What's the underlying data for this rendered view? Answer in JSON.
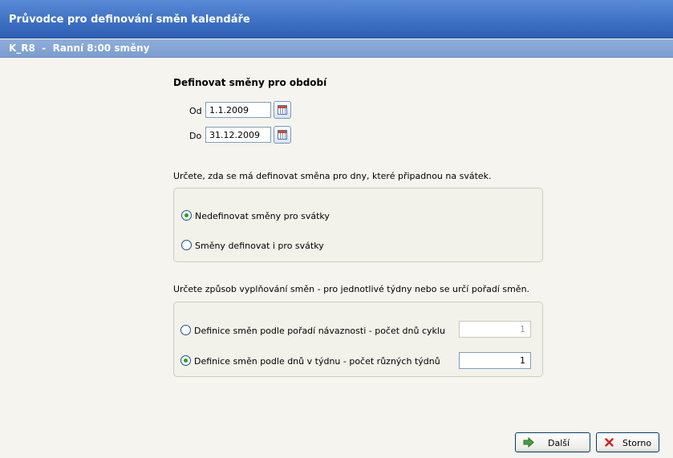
{
  "window": {
    "title": "Průvodce pro definování směn kalendáře"
  },
  "header": {
    "subtitle": "K_R8  -  Ranní 8:00 směny"
  },
  "period": {
    "heading": "Definovat směny pro období",
    "from_label": "Od",
    "from_value": "1.1.2009",
    "to_label": "Do",
    "to_value": "31.12.2009"
  },
  "holidays": {
    "prompt": "Určete, zda se má definovat směna pro dny, které připadnou na svátek.",
    "option1": "Nedefinovat směny pro svátky",
    "option2": "Směny definovat i pro svátky",
    "selected": 1
  },
  "fill_mode": {
    "prompt": "Určete způsob vyplňování směn - pro jednotlivé týdny nebo se určí pořadí směn.",
    "option1": "Definice směn podle pořadí návaznosti - počet dnů cyklu",
    "option1_value": "1",
    "option2": "Definice směn podle dnů v týdnu - počet různých týdnů",
    "option2_value": "1",
    "selected": 2
  },
  "buttons": {
    "next": "Další",
    "cancel": "Storno"
  },
  "colors": {
    "title_bar": "#3c6fc3",
    "sub_bar": "#7a9cd0",
    "background": "#f5f4ef"
  },
  "icons": [
    "calendar-icon",
    "arrow-right-icon",
    "x-cancel-icon"
  ]
}
